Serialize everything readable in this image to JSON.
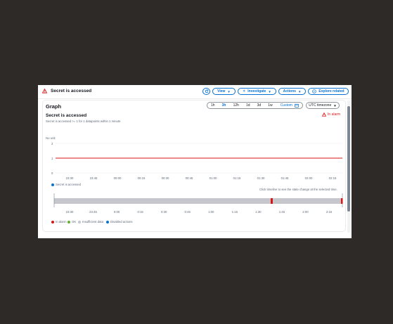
{
  "header": {
    "title": "Secret is accessed",
    "buttons": {
      "view": "View",
      "investigate": "Investigate",
      "actions": "Actions",
      "explore": "Explore related"
    }
  },
  "graph": {
    "title": "Graph",
    "ranges": [
      "1h",
      "3h",
      "12h",
      "1d",
      "3d",
      "1w",
      "Custom"
    ],
    "selected_range": "3h",
    "timezone": "UTC timezone",
    "metric_title": "Secret is accessed",
    "metric_sub": "Secret is accessed >= 1 for 1 datapoints within 1 minute",
    "alarm_state": "In alarm",
    "unit_label": "No unit",
    "y_ticks": [
      "2",
      "1",
      "0"
    ],
    "x_ticks": [
      "23:30",
      "23:45",
      "00:00",
      "00:15",
      "00:30",
      "00:45",
      "01:00",
      "01:15",
      "01:30",
      "01:45",
      "02:00",
      "02:15"
    ],
    "series_legend": "Secret is accessed",
    "timeline_hint": "Click timeline to see the state change at the selected time.",
    "timeline_ticks": [
      "23:30",
      "23:45",
      "0:00",
      "0:15",
      "0:30",
      "0:45",
      "1:00",
      "1:15",
      "1:30",
      "1:45",
      "2:00",
      "2:15"
    ],
    "state_legend": [
      {
        "label": "In alarm",
        "color": "#d91515"
      },
      {
        "label": "OK",
        "color": "#69ae34"
      },
      {
        "label": "Insufficient data",
        "color": "#c6c6cd"
      },
      {
        "label": "Disabled actions",
        "color": "#0972d3"
      }
    ]
  },
  "chart_data": {
    "type": "line",
    "ylabel": "No unit",
    "ylim": [
      0,
      2
    ],
    "x": [
      "23:30",
      "23:45",
      "00:00",
      "00:15",
      "00:30",
      "00:45",
      "01:00",
      "01:15",
      "01:30",
      "01:45",
      "02:00",
      "02:15"
    ],
    "series": [
      {
        "name": "Secret is accessed",
        "values": []
      }
    ],
    "threshold": 1,
    "threshold_color": "#d91515",
    "series_color": "#0972d3",
    "timeline_states": [
      {
        "state": "Insufficient data",
        "color": "#c6c6cd"
      },
      {
        "state": "In alarm",
        "color": "#d91515",
        "at": "01:35"
      },
      {
        "state": "In alarm",
        "color": "#d91515",
        "at": "02:20"
      }
    ]
  }
}
